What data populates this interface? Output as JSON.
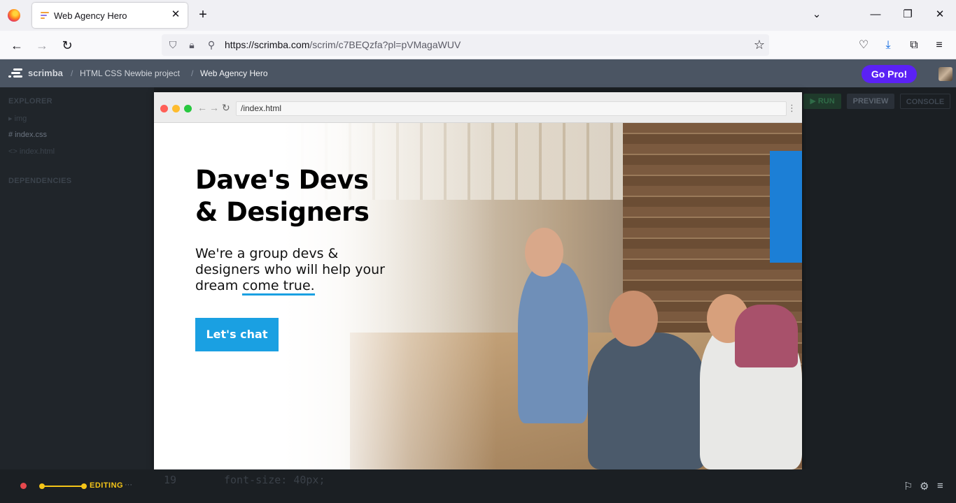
{
  "browser": {
    "tab_title": "Web Agency Hero",
    "tab_close": "✕",
    "new_tab": "+",
    "url_host": "https://scrimba.com",
    "url_path": "/scrim/c7BEQzfa?pl=pVMagaWUV",
    "icons": [
      "firefox-icon",
      "back-icon",
      "forward-icon",
      "reload-icon",
      "shield-icon",
      "lock-icon",
      "permissions-icon",
      "star-icon",
      "pocket-icon",
      "download-icon",
      "extensions-icon",
      "menu-icon"
    ]
  },
  "scrimba": {
    "brand": "scrimba",
    "crumbs": [
      "HTML CSS Newbie project",
      "Web Agency Hero"
    ],
    "go_pro": "Go Pro!",
    "sidebar": {
      "explorer": "EXPLORER",
      "files": [
        "▸ img",
        "# index.css",
        "<> index.html"
      ],
      "dependencies": "DEPENDENCIES"
    },
    "editor_buttons": [
      "▶ RUN",
      "PREVIEW",
      "CONSOLE"
    ]
  },
  "preview": {
    "url": "/index.html",
    "title_line1": "Dave's Devs",
    "title_line2": "& Designers",
    "subtitle_pre": "We're a group devs & designers who will help your dream ",
    "subtitle_highlight": "come true.",
    "cta": "Let's chat"
  },
  "bottom": {
    "status": "EDITING",
    "dots": "···",
    "line_number": "19",
    "code": "font-size: 40px;"
  },
  "colors": {
    "accent": "#1aa0e2",
    "go_pro": "#5b21f5",
    "editing": "#f5c518",
    "header": "#4b5563"
  }
}
